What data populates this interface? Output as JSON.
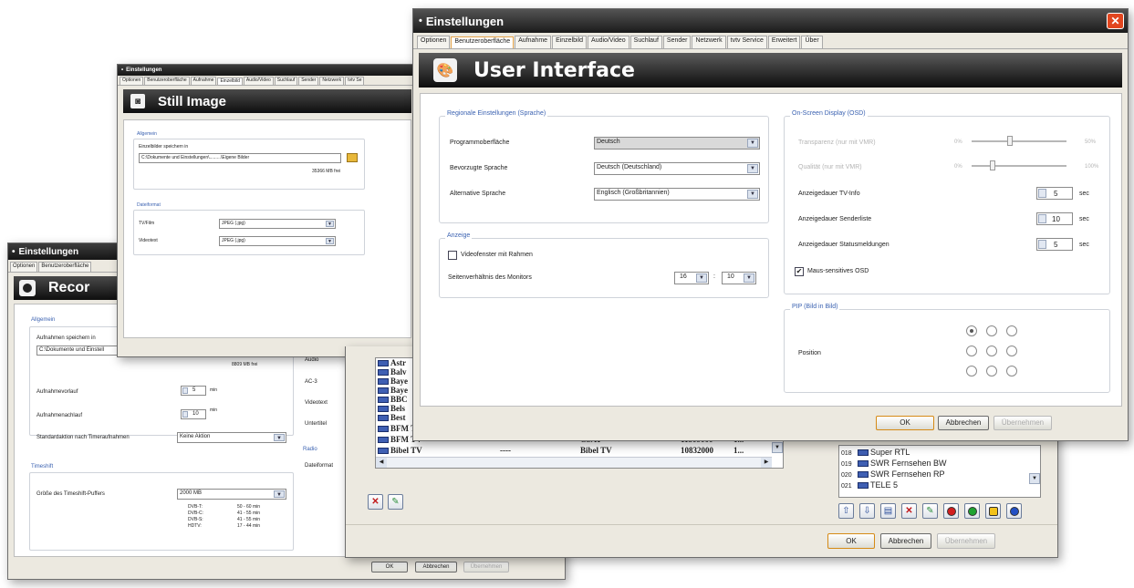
{
  "record_window": {
    "title": "Einstellungen",
    "tabs": [
      "Optionen",
      "Benutzeroberfläche"
    ],
    "banner_title": "Recor",
    "section_general": "Allgemein",
    "save_label": "Aufnahmen speichern in",
    "path_value": "C:\\Dokumente und Einstell",
    "free_space": "8809 MB frei",
    "pre_label": "Aufnahmevorlauf",
    "pre_value": "5",
    "pre_unit": "min",
    "post_label": "Aufnahmenachlauf",
    "post_value": "10",
    "post_unit": "min",
    "default_action_label": "Standardaktion nach Timeraufnahmen",
    "default_action_value": "Keine Aktion",
    "timeshift_label": "Timeshift",
    "buffer_label": "Größe des Timeshift-Puffers",
    "buffer_value": "2000 MB",
    "durations": [
      {
        "name": "DVB-T:",
        "value": "50 - 60 min"
      },
      {
        "name": "DVB-C:",
        "value": "41 - 55 min"
      },
      {
        "name": "DVB-S:",
        "value": "41 - 55 min"
      },
      {
        "name": "HDTV:",
        "value": "17 - 44 min"
      }
    ],
    "side_items": [
      "Audio",
      "AC-3",
      "Videotext",
      "Untertitel"
    ],
    "radio_group": "Radio",
    "radio_item": "Dateiformat",
    "ok": "OK",
    "cancel": "Abbrechen",
    "apply": "Übernehmen"
  },
  "still_window": {
    "title": "Einstellungen",
    "tabs": [
      "Optionen",
      "Benutzeroberfläche",
      "Aufnahme",
      "Einzelbild",
      "Audio/Video",
      "Suchlauf",
      "Sender",
      "Netzwerk",
      "tvtv Se"
    ],
    "banner_title": "Still Image",
    "section_general": "Allgemein",
    "save_label": "Einzelbilder speichern in",
    "path_value": "C:\\Dokumente und Einstellungen\\.........\\Eigene Bilder",
    "free_space": "35366 MB frei",
    "format_group": "Dateiformat",
    "tv_label": "TV/Film",
    "tv_value": "JPEG (.jpg)",
    "vt_label": "Videotext",
    "vt_value": "JPEG (.jpg)"
  },
  "channel_window": {
    "list_rows": [
      {
        "name": "Astr",
        "dash": "",
        "sat": "",
        "freq": "",
        "extra": ""
      },
      {
        "name": "Balv",
        "dash": "",
        "sat": "",
        "freq": "",
        "extra": ""
      },
      {
        "name": "Baye",
        "dash": "",
        "sat": "",
        "freq": "",
        "extra": ""
      },
      {
        "name": "Baye",
        "dash": "",
        "sat": "",
        "freq": "",
        "extra": ""
      },
      {
        "name": "BBC",
        "dash": "",
        "sat": "",
        "freq": "",
        "extra": ""
      },
      {
        "name": "Bels",
        "dash": "",
        "sat": "",
        "freq": "",
        "extra": ""
      },
      {
        "name": "Best",
        "dash": "",
        "sat": "",
        "freq": "",
        "extra": ""
      },
      {
        "name": "BFM TV",
        "dash": "----",
        "sat": "CSAT",
        "freq": "11509000",
        "extra": "1..."
      },
      {
        "name": "Bibel TV",
        "dash": "----",
        "sat": "Bibel TV",
        "freq": "10832000",
        "extra": "1..."
      }
    ],
    "right_rows": [
      {
        "num": "018",
        "name": "Super RTL"
      },
      {
        "num": "019",
        "name": "SWR Fernsehen BW"
      },
      {
        "num": "020",
        "name": "SWR Fernsehen RP"
      },
      {
        "num": "021",
        "name": "TELE 5"
      }
    ],
    "ok": "OK",
    "cancel": "Abbrechen",
    "apply": "Übernehmen"
  },
  "ui_window": {
    "title": "Einstellungen",
    "tabs": [
      "Optionen",
      "Benutzeroberfläche",
      "Aufnahme",
      "Einzelbild",
      "Audio/Video",
      "Suchlauf",
      "Sender",
      "Netzwerk",
      "tvtv Service",
      "Erweitert",
      "Über"
    ],
    "banner_title": "User Interface",
    "regional": {
      "group": "Regionale Einstellungen (Sprache)",
      "rows": [
        {
          "label": "Programmoberfläche",
          "value": "Deutsch"
        },
        {
          "label": "Bevorzugte Sprache",
          "value": "Deutsch (Deutschland)"
        },
        {
          "label": "Alternative Sprache",
          "value": "Englisch (Großbritannien)"
        }
      ]
    },
    "display": {
      "group": "Anzeige",
      "frame_label": "Videofenster mit Rahmen",
      "aspect_label": "Seitenverhältnis des Monitors",
      "aspect_w": "16",
      "aspect_sep": ":",
      "aspect_h": "10"
    },
    "osd": {
      "group": "On-Screen Display (OSD)",
      "transparency_label": "Transparenz (nur mit VMR)",
      "transparency_min": "0%",
      "transparency_max": "50%",
      "transparency_level": 0.4,
      "quality_label": "Qualität (nur mit VMR)",
      "quality_min": "0%",
      "quality_max": "100%",
      "quality_level": 0.2,
      "tvinfo_label": "Anzeigedauer TV-Info",
      "tvinfo_value": "5",
      "senderliste_label": "Anzeigedauer Senderliste",
      "senderliste_value": "10",
      "status_label": "Anzeigedauer Statusmeldungen",
      "status_value": "5",
      "unit": "sec",
      "mouse_label": "Maus-sensitives OSD",
      "mouse_checked": true
    },
    "pip": {
      "group": "PIP (Bild in Bild)",
      "position_label": "Position",
      "selected": 0
    },
    "ok": "OK",
    "cancel": "Abbrechen",
    "apply": "Übernehmen",
    "colors": {
      "accent": "#3b62b1",
      "close": "#e2461f"
    }
  }
}
